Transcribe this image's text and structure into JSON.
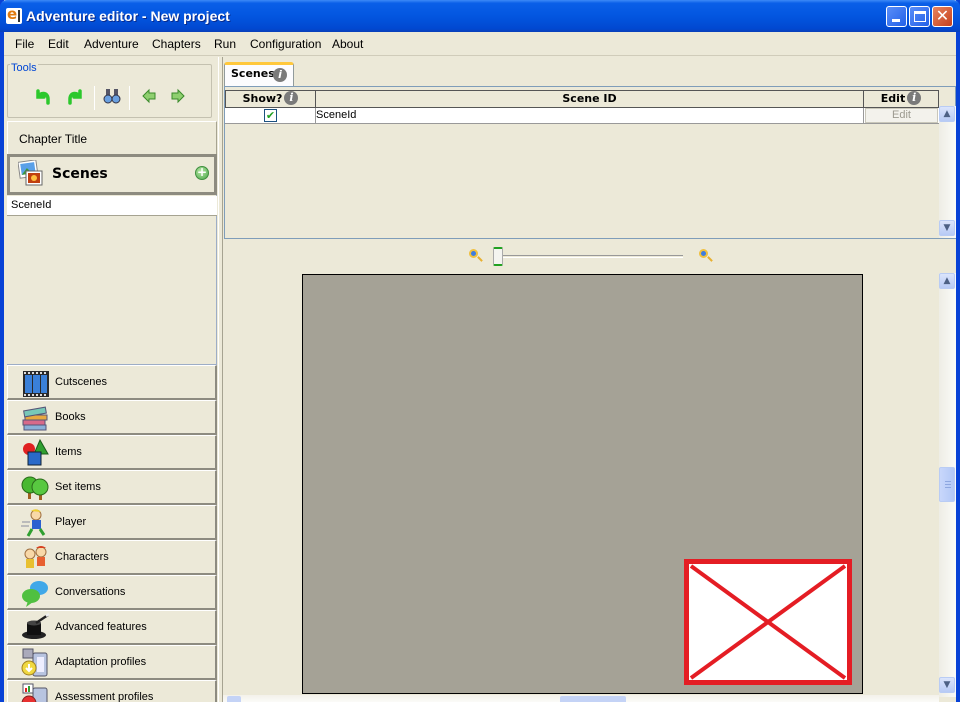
{
  "window": {
    "title": "Adventure editor - New project",
    "logo_icon": "eadventure-logo-icon",
    "controls": [
      "minimize",
      "maximize",
      "close"
    ],
    "close_glyph": "✕"
  },
  "menubar": {
    "items": [
      "File",
      "Edit",
      "Adventure",
      "Chapters",
      "Run",
      "Configuration",
      "About"
    ]
  },
  "tools": {
    "label": "Tools",
    "buttons": [
      {
        "name": "undo",
        "icon": "undo-arrow-icon",
        "glyph": "↶",
        "color": "#2cc82c"
      },
      {
        "name": "redo",
        "icon": "redo-arrow-icon",
        "glyph": "↷",
        "color": "#2cc82c"
      },
      {
        "name": "search",
        "icon": "binoculars-icon",
        "glyph": "🔭",
        "color": "#5a6fa0"
      },
      {
        "name": "back",
        "icon": "arrow-left-icon",
        "glyph": "⇦",
        "color": "#58a83a"
      },
      {
        "name": "forward",
        "icon": "arrow-right-icon",
        "glyph": "⇨",
        "color": "#58a83a"
      }
    ]
  },
  "sidebar": {
    "chapter_title": "Chapter Title",
    "scenes_section": {
      "label": "Scenes",
      "icon": "scenes-icon",
      "add_icon": "add-circle-icon",
      "add_glyph": "+",
      "items": [
        "SceneId"
      ]
    },
    "nav_items": [
      {
        "label": "Cutscenes",
        "icon": "film-strip-icon"
      },
      {
        "label": "Books",
        "icon": "books-icon"
      },
      {
        "label": "Items",
        "icon": "shapes-icon"
      },
      {
        "label": "Set items",
        "icon": "trees-icon"
      },
      {
        "label": "Player",
        "icon": "player-icon"
      },
      {
        "label": "Characters",
        "icon": "characters-icon"
      },
      {
        "label": "Conversations",
        "icon": "speech-bubbles-icon"
      },
      {
        "label": "Advanced features",
        "icon": "magic-hat-icon"
      },
      {
        "label": "Adaptation profiles",
        "icon": "adaptation-profile-icon"
      },
      {
        "label": "Assessment profiles",
        "icon": "assessment-profile-icon"
      }
    ]
  },
  "main": {
    "tab": {
      "label": "Scenes",
      "info_glyph": "i"
    },
    "table": {
      "columns": [
        {
          "label": "Show?",
          "has_info": true
        },
        {
          "label": "Scene ID",
          "has_info": false
        },
        {
          "label": "Edit",
          "has_info": true
        }
      ],
      "rows": [
        {
          "show": true,
          "scene_id": "SceneId",
          "edit_label": "Edit",
          "edit_enabled": false
        }
      ],
      "info_glyph": "i",
      "check_glyph": "✔"
    },
    "zoom": {
      "zoom_out_icon": "zoom-out-icon",
      "zoom_in_icon": "zoom-in-icon",
      "slider_value_fraction": 0.0
    },
    "scene_preview": {
      "background_color": "#a5a296",
      "missing_image_color": "#e41d24"
    },
    "scrollbars": {
      "up_glyph": "▲",
      "down_glyph": "▼"
    }
  }
}
